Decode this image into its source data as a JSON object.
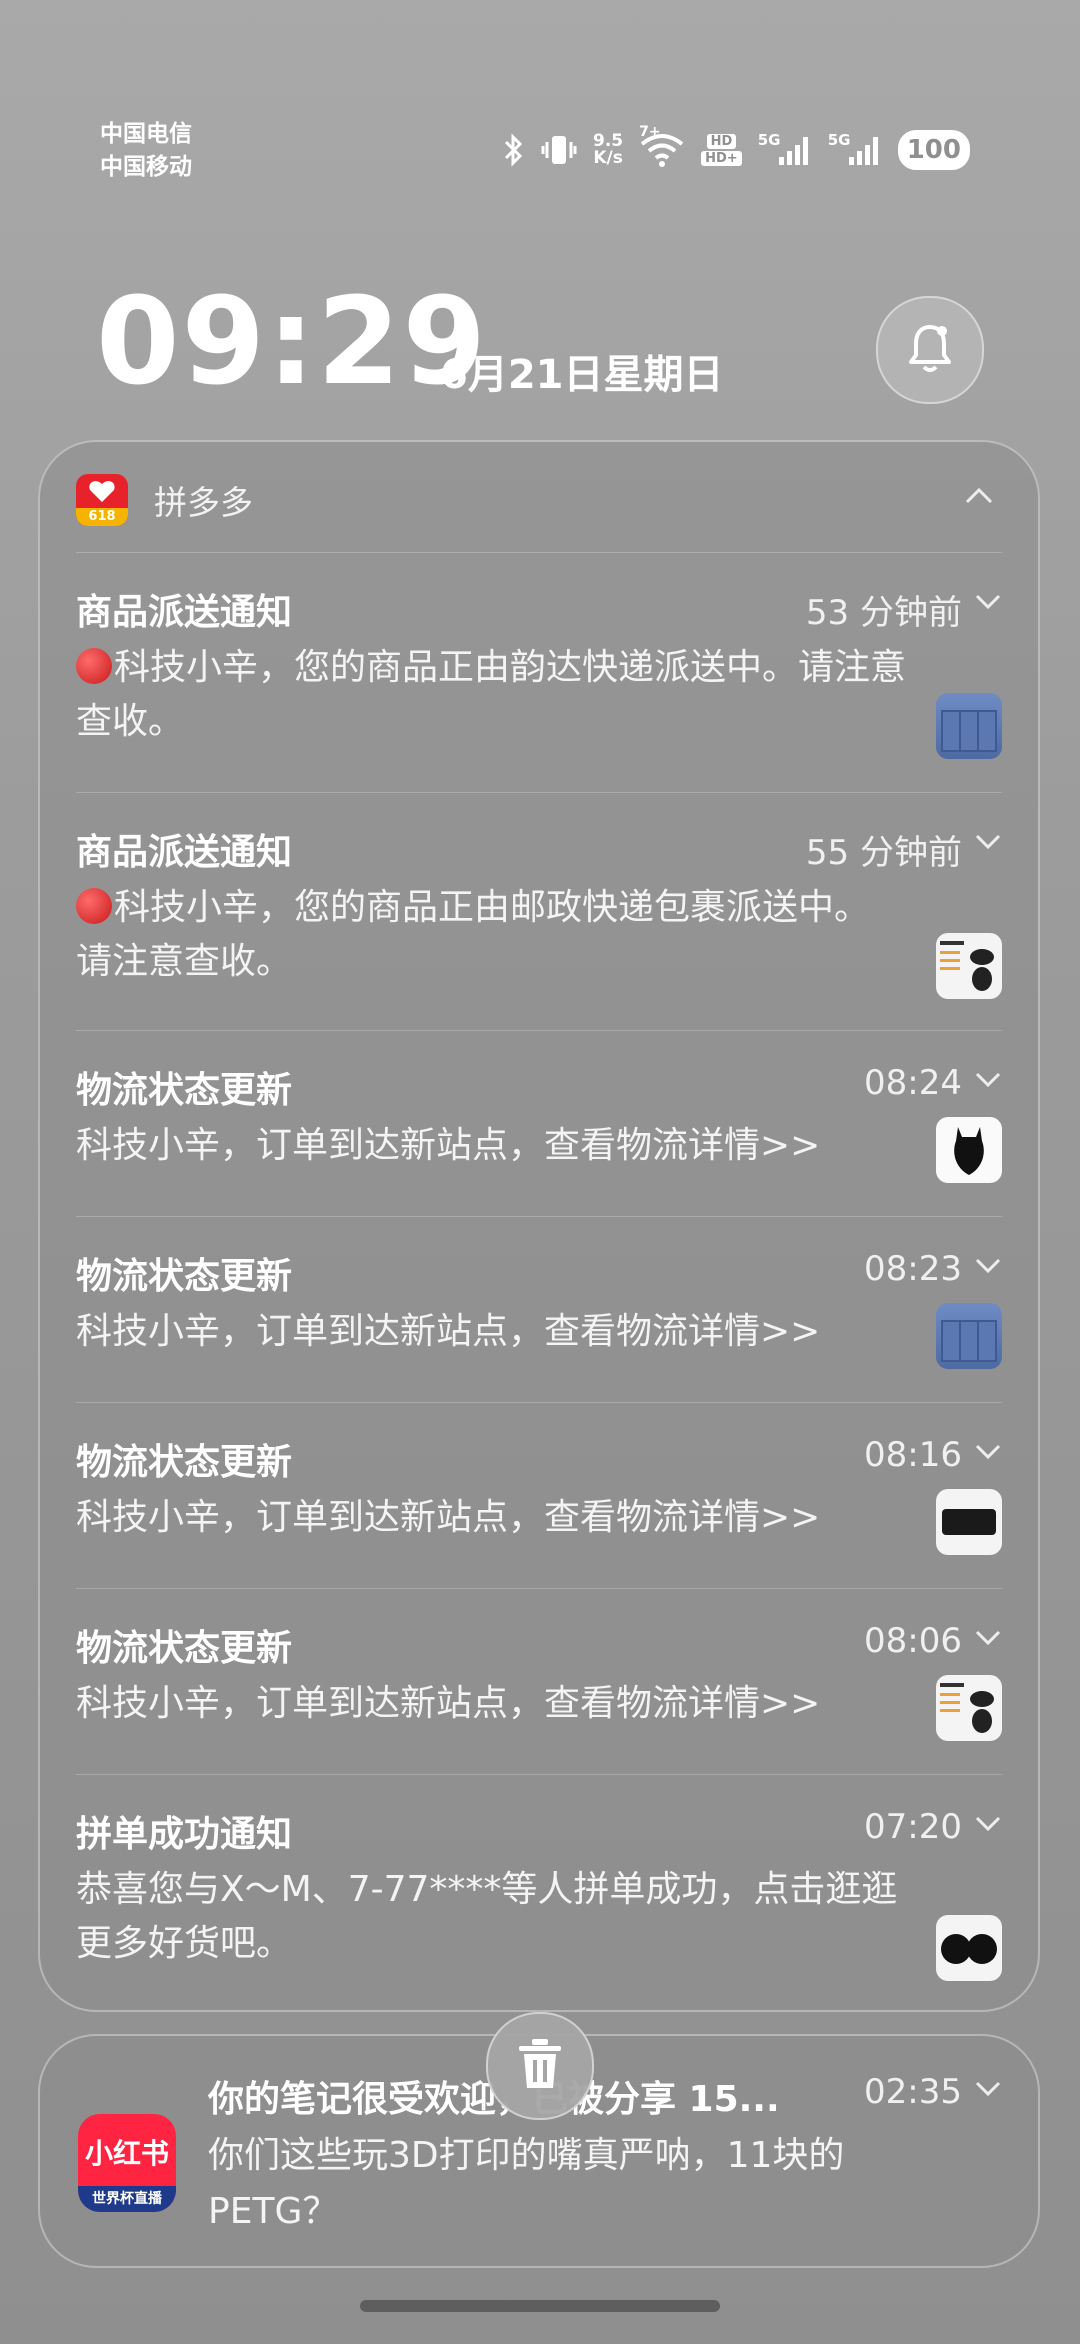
{
  "status_bar": {
    "carrier1": "中国电信",
    "carrier2": "中国移动",
    "speed_value": "9.5",
    "speed_unit": "K/s",
    "wifi_label": "7+",
    "hd1": "HD",
    "hd2": "HD+",
    "sim1_label": "5G",
    "sim2_label": "5G",
    "battery": "100"
  },
  "lock": {
    "time": "09:29",
    "date": "6月21日星期日"
  },
  "group": {
    "app_name": "拼多多",
    "app_icon_badge": "618",
    "notifications": [
      {
        "title": "商品派送通知",
        "time": "53 分钟前",
        "body": "科技小辛，您的商品正由韵达快递派送中。请注意查收。",
        "red_dot": true,
        "thumb": "blue-box"
      },
      {
        "title": "商品派送通知",
        "time": "55 分钟前",
        "body": "科技小辛，您的商品正由邮政快递包裹派送中。 请注意查收。",
        "red_dot": true,
        "thumb": "product-sheet"
      },
      {
        "title": "物流状态更新",
        "time": "08:24",
        "body": "科技小辛，订单到达新站点，查看物流详情>>",
        "red_dot": false,
        "thumb": "black-cat"
      },
      {
        "title": "物流状态更新",
        "time": "08:23",
        "body": "科技小辛，订单到达新站点，查看物流详情>>",
        "red_dot": false,
        "thumb": "blue-box"
      },
      {
        "title": "物流状态更新",
        "time": "08:16",
        "body": "科技小辛，订单到达新站点，查看物流详情>>",
        "red_dot": false,
        "thumb": "black-pad"
      },
      {
        "title": "物流状态更新",
        "time": "08:06",
        "body": "科技小辛，订单到达新站点，查看物流详情>>",
        "red_dot": false,
        "thumb": "product-sheet"
      },
      {
        "title": "拼单成功通知",
        "time": "07:20",
        "body": "恭喜您与X～M、7-77****等人拼单成功，点击逛逛更多好货吧。",
        "red_dot": false,
        "thumb": "coasters"
      }
    ]
  },
  "second_card": {
    "app_icon_text": "小红书",
    "app_icon_sub": "世界杯直播",
    "title": "你的笔记很受欢迎，已被分享 15...",
    "time": "02:35",
    "body": "你们这些玩3D打印的嘴真严呐，11块的PETG？"
  },
  "colors": {
    "pdd_red": "#e8222b",
    "xhs_red": "#ff2442",
    "background": "#9c9c9c"
  }
}
